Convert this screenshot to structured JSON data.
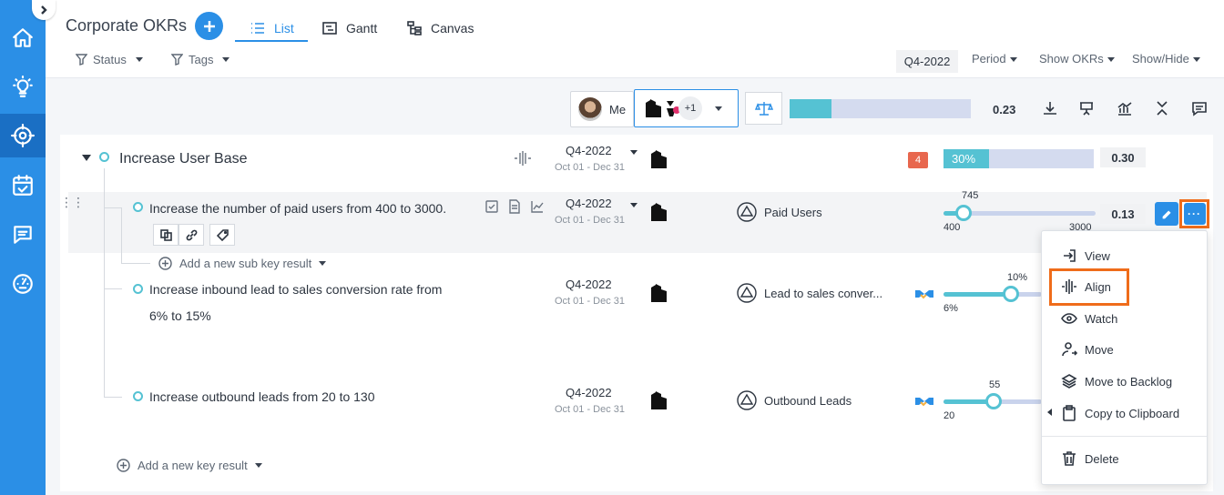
{
  "nav": {
    "items": [
      {
        "name": "home-icon"
      },
      {
        "name": "lightbulb-icon"
      },
      {
        "name": "target-icon"
      },
      {
        "name": "calendar-check-icon"
      },
      {
        "name": "chat-icon"
      },
      {
        "name": "dashboard-gauge-icon"
      }
    ],
    "active_index": 2
  },
  "header": {
    "title": "Corporate OKRs",
    "tabs": [
      {
        "label": "List",
        "icon": "list-icon",
        "active": true
      },
      {
        "label": "Gantt",
        "icon": "gantt-icon",
        "active": false
      },
      {
        "label": "Canvas",
        "icon": "canvas-tree-icon",
        "active": false
      }
    ],
    "filters": [
      {
        "label": "Status",
        "icon": "filter-icon"
      },
      {
        "label": "Tags",
        "icon": "filter-icon"
      }
    ],
    "period_badge": "Q4-2022",
    "menus": [
      {
        "label": "Period"
      },
      {
        "label": "Show OKRs"
      },
      {
        "label": "Show/Hide"
      }
    ]
  },
  "toolbar": {
    "me_label": "Me",
    "team_extra": "+1",
    "overall_progress": 0.23,
    "overall_value": "0.23"
  },
  "objective": {
    "title": "Increase User Base",
    "quarter": "Q4-2022",
    "dates": "Oct 01 - Dec 31",
    "badge_count": "4",
    "progress_label": "30%",
    "progress": 0.3,
    "score": "0.30"
  },
  "key_results": [
    {
      "title": "Increase the number of paid users from 400 to 3000.",
      "quarter": "Q4-2022",
      "dates": "Oct 01 - Dec 31",
      "kpi": "Paid Users",
      "current": "745",
      "start": "400",
      "target": "3000",
      "score": "0.13",
      "add_sub_label": "Add a new sub key result"
    },
    {
      "title_line1": "Increase inbound lead to sales conversion rate from",
      "title_line2": "6% to 15%",
      "quarter": "Q4-2022",
      "dates": "Oct 01 - Dec 31",
      "kpi": "Lead to sales conver...",
      "current": "10%",
      "start": "6%"
    },
    {
      "title": "Increase outbound leads from 20 to 130",
      "quarter": "Q4-2022",
      "dates": "Oct 01 - Dec 31",
      "kpi": "Outbound Leads",
      "current": "55",
      "start": "20"
    }
  ],
  "add_key_result_label": "Add a new key result",
  "context_menu": {
    "items": [
      {
        "label": "View",
        "icon": "view-enter-icon"
      },
      {
        "label": "Align",
        "icon": "align-icon"
      },
      {
        "label": "Watch",
        "icon": "eye-icon"
      },
      {
        "label": "Move",
        "icon": "user-move-icon"
      },
      {
        "label": "Move to Backlog",
        "icon": "layers-icon"
      },
      {
        "label": "Copy to Clipboard",
        "icon": "clipboard-icon"
      },
      {
        "label": "Delete",
        "icon": "trash-icon"
      }
    ]
  },
  "colors": {
    "brand": "#2b8fe6",
    "progress": "#55c2d3",
    "track": "#d4dbef",
    "highlight": "#ef6c1a",
    "badge": "#e8674e"
  }
}
